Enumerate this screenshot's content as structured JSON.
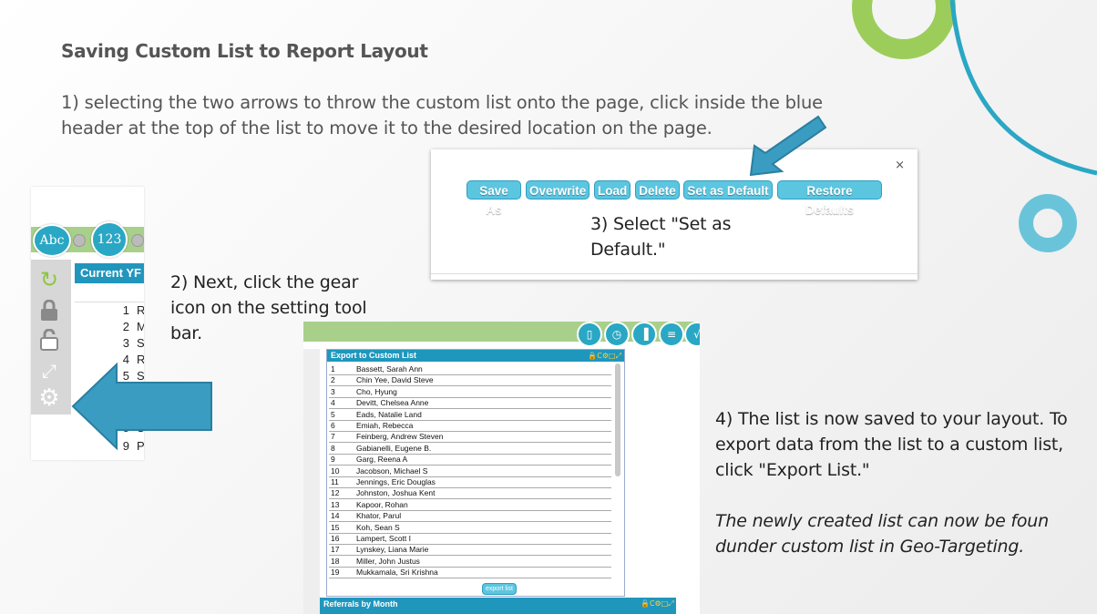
{
  "slide": {
    "title": "Saving Custom List to Report Layout",
    "step1": "1) selecting the two arrows to throw the custom list onto the page, click inside the blue header at the top of the list to move it to the desired location on the page.",
    "step2": "2) Next, click the gear icon on the setting tool bar.",
    "step3": "3) Select \"Set as Default.\"",
    "step4": "4) The list is now saved to your layout. To export data from the list to a custom list, click \"Export List.\"",
    "note": "The newly created list can now be foun dunder custom list in Geo-Targeting."
  },
  "toolbar_shot": {
    "abc_label": "Abc",
    "num_label": "123",
    "grid_header": "Current YF",
    "rows": [
      {
        "n": "1",
        "t": "R"
      },
      {
        "n": "2",
        "t": "M"
      },
      {
        "n": "3",
        "t": "S"
      },
      {
        "n": "4",
        "t": "R"
      },
      {
        "n": "5",
        "t": "S"
      },
      {
        "n": "8",
        "t": "S"
      },
      {
        "n": "9",
        "t": "P"
      }
    ]
  },
  "dialog": {
    "close": "×",
    "buttons": [
      "Save As",
      "Overwrite",
      "Load",
      "Delete",
      "Set as Default",
      "Restore Defaults"
    ]
  },
  "list_shot": {
    "header": "Export to Custom List",
    "header_icons": "🔒C⚙□⤢",
    "rows": [
      {
        "n": "1",
        "name": "Bassett, Sarah Ann"
      },
      {
        "n": "2",
        "name": "Chin Yee, David Steve"
      },
      {
        "n": "3",
        "name": "Cho, Hyung"
      },
      {
        "n": "4",
        "name": "Devitt, Chelsea Anne"
      },
      {
        "n": "5",
        "name": "Eads, Natalie Land"
      },
      {
        "n": "6",
        "name": "Emiah, Rebecca"
      },
      {
        "n": "7",
        "name": "Feinberg, Andrew Steven"
      },
      {
        "n": "8",
        "name": "Gabianelli, Eugene B."
      },
      {
        "n": "9",
        "name": "Garg, Reena A"
      },
      {
        "n": "10",
        "name": "Jacobson, Michael S"
      },
      {
        "n": "11",
        "name": "Jennings, Eric Douglas"
      },
      {
        "n": "12",
        "name": "Johnston, Joshua Kent"
      },
      {
        "n": "13",
        "name": "Kapoor, Rohan"
      },
      {
        "n": "14",
        "name": "Khator, Parul"
      },
      {
        "n": "15",
        "name": "Koh, Sean S"
      },
      {
        "n": "16",
        "name": "Lampert, Scott I"
      },
      {
        "n": "17",
        "name": "Lynskey, Liana Marie"
      },
      {
        "n": "18",
        "name": "Miller, John Justus"
      },
      {
        "n": "19",
        "name": "Mukkamala, Sri Krishna"
      }
    ],
    "export_button": "export list",
    "second_panel": "Referrals by Month"
  },
  "colors": {
    "accent_blue": "#2aa7c4",
    "accent_green": "#8cc63f",
    "arrow_blue": "#3a9cc0"
  }
}
